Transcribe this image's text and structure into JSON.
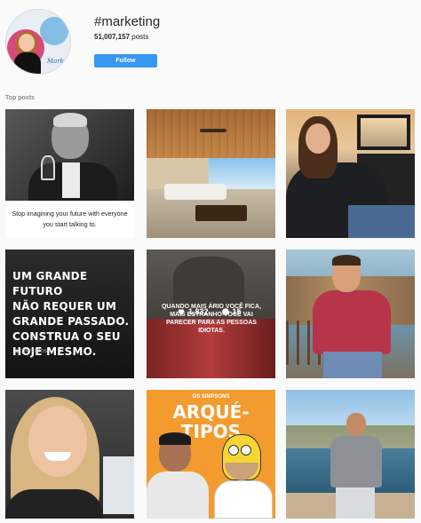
{
  "header": {
    "hashtag": "#marketing",
    "posts_count": "51,007,157",
    "posts_label": "posts",
    "follow_label": "Follow",
    "avatar_signature": "Marketing"
  },
  "section": {
    "title": "Top posts"
  },
  "posts": [
    {
      "image": "man-drinking-wine-photo",
      "caption": "Stop imagining your future with everyone you start talking to."
    },
    {
      "image": "luxury-living-room-photo"
    },
    {
      "image": "woman-in-car-photo"
    },
    {
      "image": "motivational-text-image",
      "text_lines": [
        "UM GRANDE FUTURO",
        "NÃO REQUER UM",
        "GRANDE PASSADO.",
        "CONSTRUA O SEU",
        "HOJE MESMO."
      ],
      "credit": "@CONTEUDOS"
    },
    {
      "image": "group-photo",
      "overlay_text": "QUANDO MAIS ÁRIO VOCÊ FICA, MAIS ESTRANHO VOCÊ VAI PARECER PARA AS PESSOAS IDIOTAS.",
      "likes": "1,832",
      "comments": "15"
    },
    {
      "image": "man-red-shirt-photo"
    },
    {
      "image": "smiling-woman-photo"
    },
    {
      "image": "simpsons-archetypes-image",
      "top_label": "OS SIMPSONS",
      "title": "ARQUÉ-TIPOS"
    },
    {
      "image": "man-on-beach-photo"
    }
  ]
}
